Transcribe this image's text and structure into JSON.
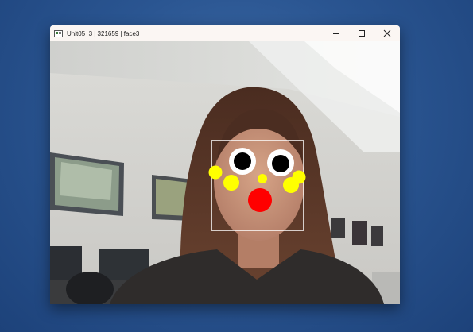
{
  "window": {
    "title": "Unit05_3 | 321659 | face3",
    "controls": {
      "minimize_icon": "minimize-icon",
      "maximize_icon": "maximize-icon",
      "close_icon": "close-icon"
    }
  },
  "overlay": {
    "face_box_color": "#ffffff",
    "eye_white_color": "#ffffff",
    "pupil_color": "#000000",
    "cheek_color": "#ffff00",
    "nose_color": "#ffff00",
    "mouth_color": "#ff0000"
  },
  "desktop_color": "#2a5591"
}
